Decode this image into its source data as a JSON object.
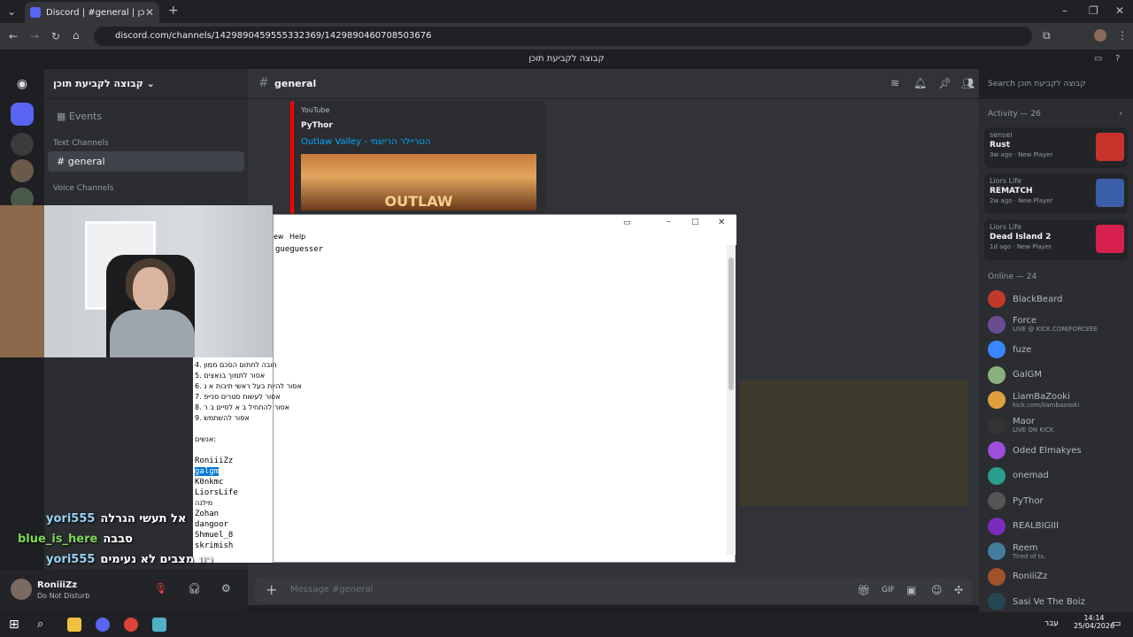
{
  "browser": {
    "tab_title": "Discord | #general | קבוצה לקביעת תוכן",
    "url": "discord.com/channels/1429890459555332369/1429890460708503676",
    "new_tab": "+",
    "tab_close": "✕"
  },
  "discord": {
    "window_title": "קבוצה לקביעת תוכן",
    "server_name": "קבוצה לקביעת תוכן",
    "events_label": "Events",
    "text_channels_label": "Text Channels",
    "voice_channels_label": "Voice Channels",
    "current_channel": "general",
    "channel_hash": "#",
    "search_placeholder": "Search קבוצה לקביעת תוכן",
    "message_placeholder": "Message #general"
  },
  "embed": {
    "source": "YouTube",
    "author": "PyThor",
    "title": "Outlaw Valley - הטריילר הרישמי",
    "thumb_text": "OUTLAW"
  },
  "user_panel": {
    "username": "RoniiiZz",
    "status": "Do Not Disturb"
  },
  "activity": {
    "header": "Activity — 26",
    "cards": [
      {
        "name": "sensei",
        "game": "Rust",
        "meta": "3w ago · New Player",
        "color": "#c8322b"
      },
      {
        "name": "Liors Life",
        "game": "REMATCH",
        "meta": "2w ago · New Player",
        "color": "#3b5ea8"
      },
      {
        "name": "Liors Life",
        "game": "Dead Island 2",
        "meta": "1d ago · New Player",
        "color": "#d6204e"
      }
    ]
  },
  "online": {
    "header": "Online — 24",
    "members": [
      {
        "name": "BlackBeard",
        "status": ""
      },
      {
        "name": "Force",
        "status": "LIVE @ KICK.COM/FORCEEE"
      },
      {
        "name": "fuze",
        "status": ""
      },
      {
        "name": "GalGM",
        "status": ""
      },
      {
        "name": "LiamBaZooki",
        "status": "kick.com/liambazooki"
      },
      {
        "name": "Maor",
        "status": "LIVE ON KICK"
      },
      {
        "name": "Oded Elmakyes",
        "status": ""
      },
      {
        "name": "onemad",
        "status": ""
      },
      {
        "name": "PyThor",
        "status": ""
      },
      {
        "name": "REALBIGIII",
        "status": ""
      },
      {
        "name": "Reem",
        "status": "Tired of ts."
      },
      {
        "name": "RoniiiZz",
        "status": ""
      },
      {
        "name": "Sasi Ve The Boiz",
        "status": ""
      }
    ]
  },
  "notepad": {
    "menu_partial": "ew",
    "menu_help": "Help",
    "first_line": "gueguesser",
    "rules": [
      "4. חובה לחתום הסכם ממון",
      "5. אסור לתמוך בנאצים",
      "6. אסור להיות בעל ראשי תיבות א נ",
      "7. אסור לעשות סטרים סנייפ",
      "8. אסור להתחיל ב א לסיים ב ר",
      "9. אסור להשתמש"
    ],
    "people_label": "אנשים:",
    "people": [
      "RoniiiZz",
      "galgm",
      "K0nkmc",
      "LiorsLife",
      "מילנה",
      "Zohan",
      "dangoor",
      "Shmuel_8",
      "skrimish"
    ]
  },
  "chat_overlay": [
    {
      "user": "yori555",
      "msg": "אל תעשי הגרלה"
    },
    {
      "user": "blue_is_here",
      "msg": "סבבה"
    },
    {
      "user": "yori555",
      "msg": "רה מצבים לא נעימים"
    }
  ],
  "taskbar": {
    "time": "14:14",
    "date": "25/04/2026",
    "lang": "עבר"
  }
}
